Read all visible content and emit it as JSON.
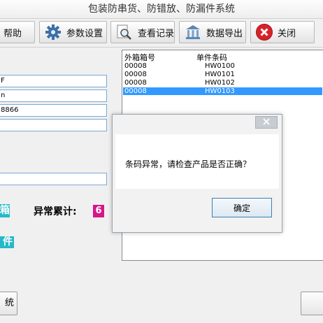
{
  "window": {
    "title": "包装防串货、防错放、防漏件系统"
  },
  "toolbar": {
    "help": "帮助",
    "settings": "参数设置",
    "records": "查看记录",
    "export": "数据导出",
    "close": "关闭"
  },
  "fields": {
    "f1": "F",
    "f2": "n",
    "f3": "8866",
    "f4": "",
    "f5": ""
  },
  "status": {
    "left_box_text": "箱",
    "abnormal_label": "异常累计:",
    "abnormal_count": "6",
    "pieces_box_text": "件"
  },
  "list": {
    "col_outer": "外箱箱号",
    "col_item": "单件条码",
    "rows": [
      {
        "outer": "00008",
        "item": "HW0100",
        "selected": false
      },
      {
        "outer": "00008",
        "item": "HW0101",
        "selected": false
      },
      {
        "outer": "00008",
        "item": "HW0102",
        "selected": false
      },
      {
        "outer": "00008",
        "item": "HW0103",
        "selected": true
      }
    ]
  },
  "dialog": {
    "message": "条码异常，请检查产品是否正确？",
    "ok_label": "确定"
  },
  "bottom": {
    "left_button": "统",
    "right_button": ""
  },
  "colors": {
    "selection": "#3399ff",
    "cyan_box": "#25b8c9",
    "count_badge": "#d6168a",
    "close_icon": "#d8222a",
    "field_border": "#7aa7d8"
  }
}
